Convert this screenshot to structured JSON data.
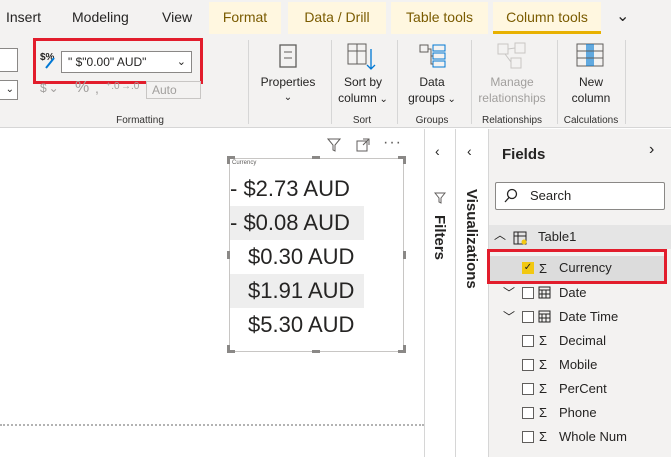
{
  "tabs": {
    "insert": "Insert",
    "modeling": "Modeling",
    "view": "View",
    "format": "Format",
    "data_drill": "Data / Drill",
    "table_tools": "Table tools",
    "column_tools": "Column tools",
    "more": "⌄"
  },
  "ribbon": {
    "format_value": "\" $\"0.00\" AUD\"",
    "auto_label": "Auto",
    "formatting_group": "Formatting",
    "properties_label": "Properties",
    "sort_by_column": [
      "Sort by",
      "column"
    ],
    "sort_group": "Sort",
    "data_groups": [
      "Data",
      "groups"
    ],
    "groups_group": "Groups",
    "manage_relationships": [
      "Manage",
      "relationships"
    ],
    "relationships_group": "Relationships",
    "new_column": [
      "New",
      "column"
    ],
    "calculations_group": "Calculations"
  },
  "visual": {
    "title": "Currency",
    "rows": [
      "- $2.73 AUD",
      "- $0.08 AUD",
      "$0.30 AUD",
      "$1.91 AUD",
      "$5.30 AUD"
    ]
  },
  "panes": {
    "filters": "Filters",
    "visualizations": "Visualizations",
    "fields": "Fields",
    "search_placeholder": "Search"
  },
  "fields": {
    "table_name": "Table1",
    "items": [
      {
        "label": "Currency",
        "checked": true,
        "icon": "sigma"
      },
      {
        "label": "Date",
        "checked": false,
        "icon": "calendar"
      },
      {
        "label": "Date Time",
        "checked": false,
        "icon": "calendar"
      },
      {
        "label": "Decimal",
        "checked": false,
        "icon": "sigma"
      },
      {
        "label": "Mobile",
        "checked": false,
        "icon": "sigma"
      },
      {
        "label": "PerCent",
        "checked": false,
        "icon": "sigma"
      },
      {
        "label": "Phone",
        "checked": false,
        "icon": "sigma"
      },
      {
        "label": "Whole Num",
        "checked": false,
        "icon": "sigma"
      }
    ]
  },
  "colors": {
    "accent": "#e8b100",
    "highlight_red": "#e21d2c",
    "check_yellow": "#f2c811"
  }
}
